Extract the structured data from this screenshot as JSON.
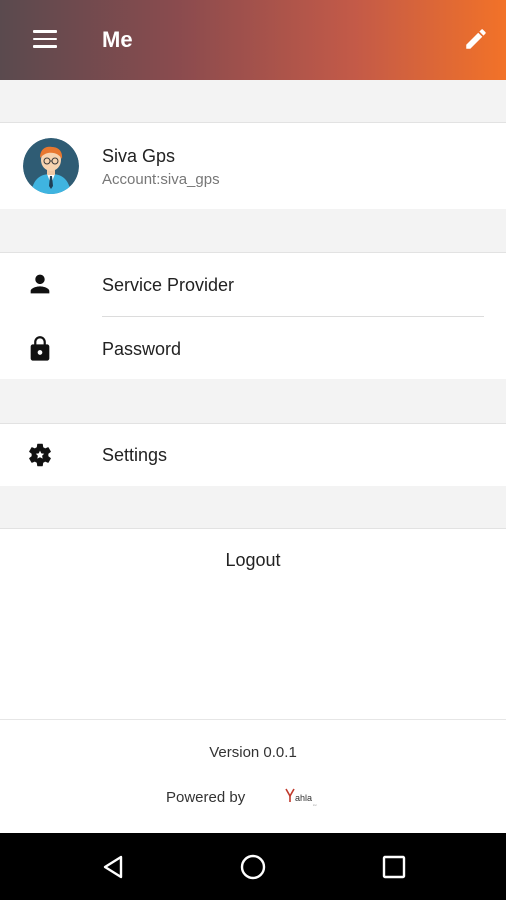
{
  "appbar": {
    "title": "Me"
  },
  "profile": {
    "name": "Siva Gps",
    "account": "Account:siva_gps"
  },
  "menu": {
    "service_provider": "Service Provider",
    "password": "Password",
    "settings": "Settings",
    "logout": "Logout"
  },
  "footer": {
    "version": "Version 0.0.1",
    "powered_by": "Powered by",
    "logo_text": "Yahla"
  },
  "icons": {
    "menu": "hamburger-icon",
    "edit": "pencil-icon",
    "service_provider": "person-icon",
    "password": "lock-icon",
    "settings": "gear-icon",
    "nav_back": "triangle-back-icon",
    "nav_home": "circle-home-icon",
    "nav_recents": "square-recents-icon"
  },
  "colors": {
    "appbar_start": "#5a4a4e",
    "appbar_end": "#f27228",
    "section_gap": "#f3f3f3",
    "navbar": "#000000"
  }
}
